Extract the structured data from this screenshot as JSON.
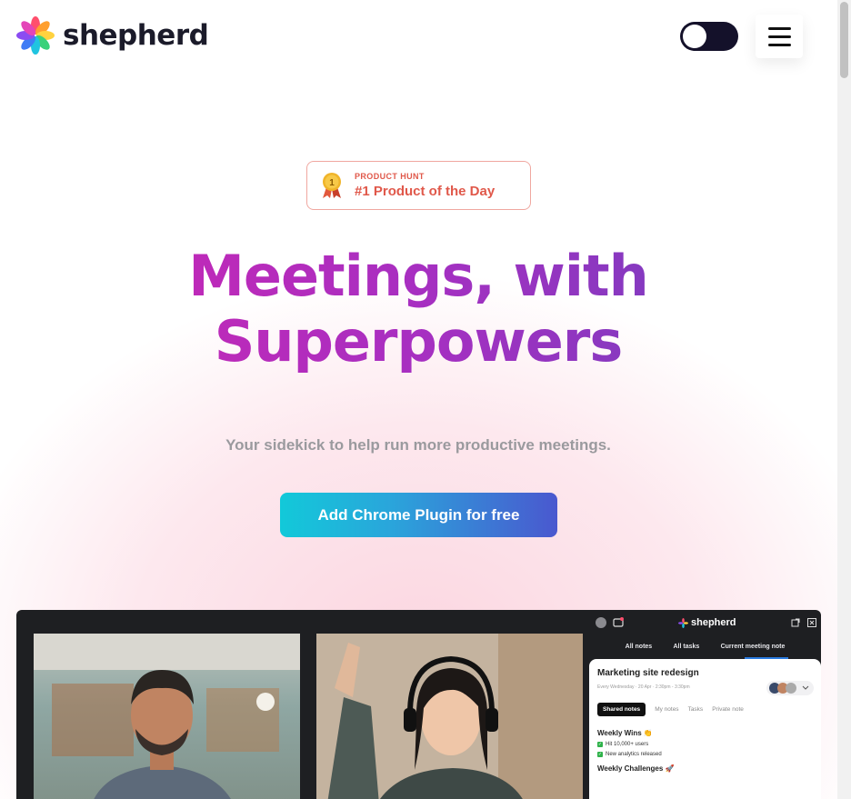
{
  "header": {
    "brand": "shepherd",
    "theme_toggle_state": "dark",
    "menu_icon": "hamburger-icon"
  },
  "badge": {
    "eyebrow": "PRODUCT HUNT",
    "title": "#1 Product of the Day",
    "icon": "medal-icon"
  },
  "hero": {
    "headline_line1": "Meetings, with",
    "headline_line2": "Superpowers",
    "subhead": "Your sidekick to help run more productive meetings.",
    "cta_label": "Add Chrome Plugin for free"
  },
  "app_preview": {
    "panel_brand": "shepherd",
    "tabs": [
      "All notes",
      "All tasks",
      "Current meeting note"
    ],
    "meeting_title": "Marketing site redesign",
    "meeting_meta": "Every Wednesday · 20 Apr · 2:30pm - 3:30pm",
    "note_tabs": [
      "Shared notes",
      "My notes",
      "Tasks",
      "Private note"
    ],
    "sections": [
      {
        "heading": "Weekly Wins 👏",
        "items": [
          "Hit 10,000+ users",
          "New analytics released"
        ]
      },
      {
        "heading": "Weekly Challenges 🚀",
        "items": []
      }
    ]
  },
  "colors": {
    "accent_pink": "#c628b6",
    "accent_purple": "#7a3dbf",
    "badge_red": "#e0584a",
    "cta_start": "#12c9d9",
    "cta_end": "#4a58cf"
  }
}
